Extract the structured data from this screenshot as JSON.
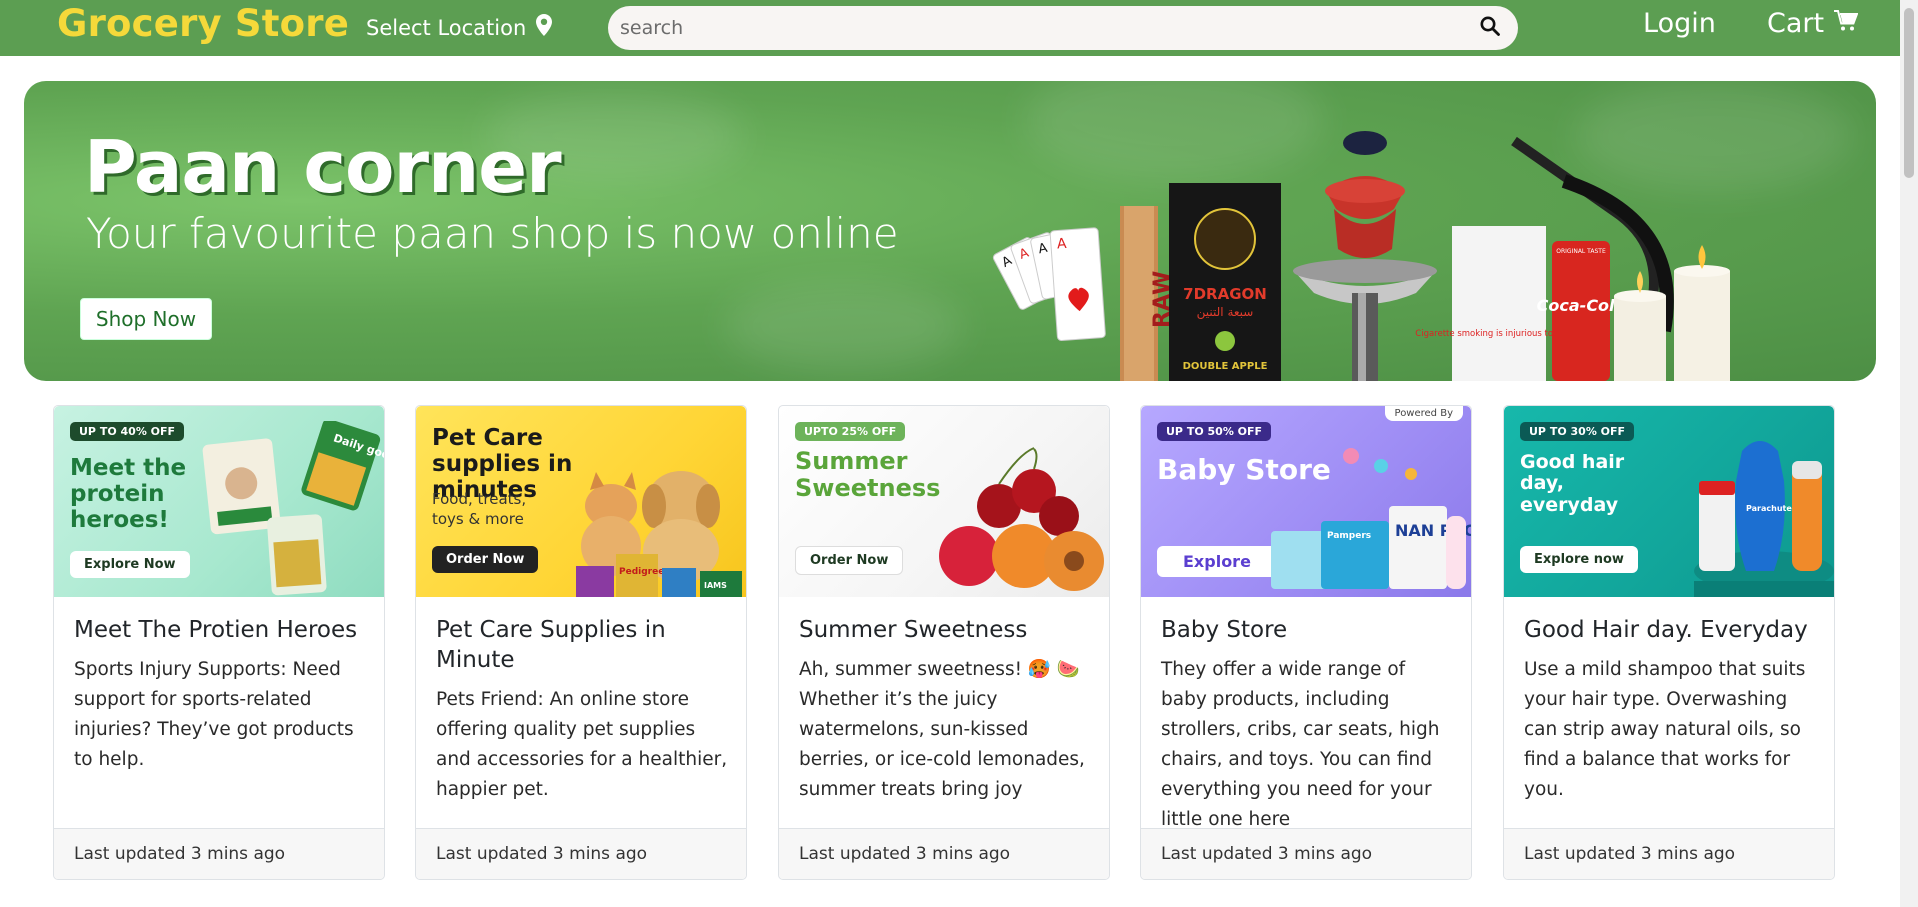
{
  "navbar": {
    "brand": "Grocery Store",
    "location_label": "Select Location",
    "search_placeholder": "search",
    "login_label": "Login",
    "cart_label": "Cart"
  },
  "hero": {
    "title": "Paan corner",
    "subtitle": "Your favourite paan shop is now online",
    "button_label": "Shop Now",
    "art_text": {
      "raw": "RAW",
      "dragon": "7DRAGON",
      "dragon_arabic": "سبعة التنين",
      "dragon_flavour": "DOUBLE APPLE",
      "cig_warning": "Cigarette smoking is injurious to health",
      "coke": "Coca-Cola",
      "coke_small": "ORIGINAL TASTE"
    }
  },
  "cards": [
    {
      "image": {
        "badge": "UP TO 40% OFF",
        "headline": "Meet the protein heroes!",
        "button": "Explore Now",
        "pack_label": "Daily good"
      },
      "title": "Meet The Protien Heroes",
      "text": "Sports Injury Supports: Need support for sports-related injuries? They’ve got products to help.",
      "footer": "Last updated 3 mins ago"
    },
    {
      "image": {
        "headline": "Pet Care supplies in minutes",
        "sub": "Food, treats, toys & more",
        "button": "Order Now",
        "pack_label": "Pedigree",
        "pack_label_2": "IAMS"
      },
      "title": "Pet Care Supplies in Minute",
      "text": "Pets Friend: An online store offering quality pet supplies and accessories for a healthier, happier pet.",
      "footer": "Last updated 3 mins ago"
    },
    {
      "image": {
        "badge": "UPTO 25% OFF",
        "headline": "Summer Sweetness",
        "button": "Order Now"
      },
      "title": "Summer Sweetness",
      "text": "Ah, summer sweetness! 🥵 🍉 Whether it’s the juicy watermelons, sun-kissed berries, or ice-cold lemonades, summer treats bring joy",
      "footer": "Last updated 3 mins ago"
    },
    {
      "image": {
        "badge": "UP TO 50% OFF",
        "headline": "Baby Store",
        "button": "Explore",
        "powered": "Powered By",
        "pack_label": "NAN PRO",
        "pack_label_2": "Pampers"
      },
      "title": "Baby Store",
      "text": "They offer a wide range of baby products, including strollers, cribs, car seats, high chairs, and toys. You can find everything you need for your little one here",
      "footer": "Last updated 3 mins ago"
    },
    {
      "image": {
        "badge": "UP TO 30% OFF",
        "headline": "Good hair day, everyday",
        "button": "Explore now",
        "pack_label": "Parachute"
      },
      "title": "Good Hair day. Everyday",
      "text": "Use a mild shampoo that suits your hair type. Overwashing can strip away natural oils, so find a balance that works for you.",
      "footer": "Last updated 3 mins ago"
    }
  ],
  "colors": {
    "navbar_bg": "#5c9e52",
    "brand": "#f5d93a",
    "hero_bg": "#5fa452"
  }
}
